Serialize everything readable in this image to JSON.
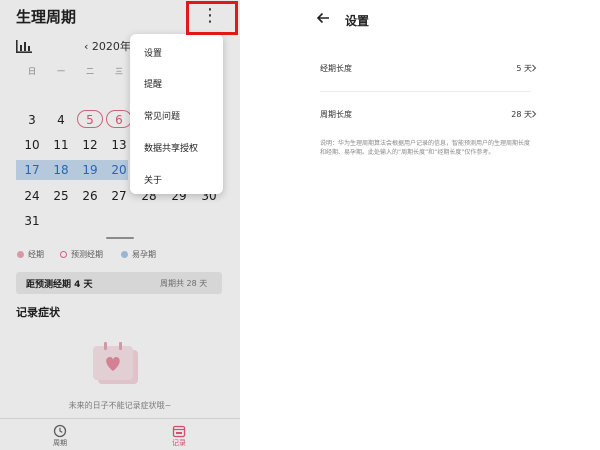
{
  "left": {
    "title": "生理周期",
    "more_glyph": "⋮",
    "month_label": "2020年",
    "week_days": [
      "日",
      "一",
      "二",
      "三"
    ],
    "rows": [
      [
        "3",
        "4",
        "5",
        "6"
      ],
      [
        "10",
        "11",
        "12",
        "13"
      ],
      [
        "17",
        "18",
        "19",
        "20"
      ],
      [
        "24",
        "25",
        "26",
        "27",
        "28",
        "29",
        "30"
      ],
      [
        "31"
      ]
    ],
    "legend": [
      "经期",
      "预测经期",
      "易孕期"
    ],
    "status_left": "距预测经期 4 天",
    "status_right": "周期共 28 天",
    "section_title": "记录症状",
    "empty_text": "未来的日子不能记录症状哦~",
    "tabs": [
      "周期",
      "记录"
    ],
    "colors": {
      "accent": "#e8577a",
      "fertile": "#c9dcf2",
      "highlight_box": "#e01818"
    }
  },
  "menu": {
    "items": [
      "设置",
      "提醒",
      "常见问题",
      "数据共享授权",
      "关于"
    ]
  },
  "right": {
    "title": "设置",
    "rows": [
      {
        "label": "经期长度",
        "value": "5 天"
      },
      {
        "label": "周期长度",
        "value": "28 天"
      }
    ],
    "note": "说明：华为生理周期算法会根据用户记录的信息，智能预测用户的生理周期长度和经期、易孕期。此处输入的“周期长度”和“经期长度”仅作参考。"
  }
}
